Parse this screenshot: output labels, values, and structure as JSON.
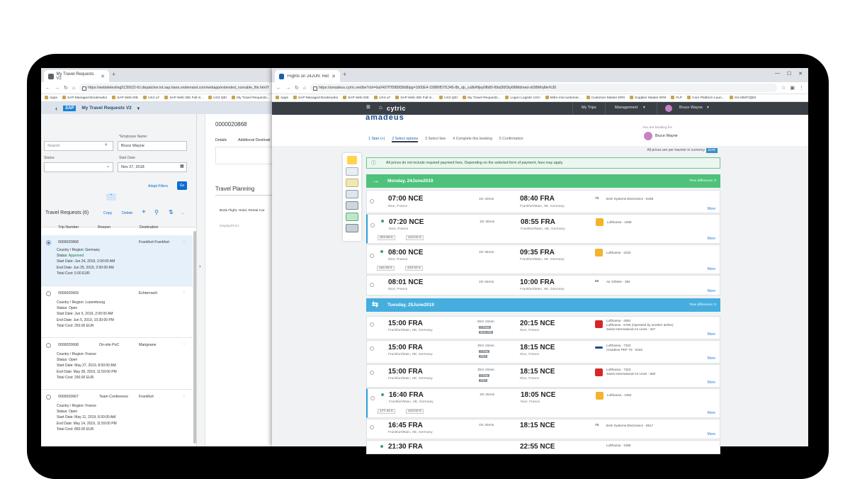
{
  "left_browser": {
    "tab_title": "My Travel Requests V2",
    "url": "https://webidetesting5135622-fcl.dispatcher.int.sap.hana.ondemand.com/webapp/extended_runnable_file.html?hc_orionpath=%2FDI_webide_di_workspace4psvg1bywtw1lb6%2Ftest1&neo-di-affinity=BIGipServerdisapwebide.dc4..",
    "bookmarks": [
      "Apps",
      "SAP Managed Bookmarks",
      "SAP Web IDE",
      "UX4 LF",
      "SAP Web IDE Full-S...",
      "UX3 QEI",
      "My Travel Requests..."
    ],
    "shell_title": "My Travel Requests V2",
    "employee_label": "*Employee Name:",
    "employee_value": "Bruce Wayne",
    "search_placeholder": "Search",
    "status_label": "Status:",
    "start_date_label": "Start Date:",
    "start_date_value": "Nov 27, 2018",
    "adapt_filters": "Adapt Filters",
    "go": "Go",
    "list_title": "Travel Requests (6)",
    "copy": "Copy",
    "delete": "Delete",
    "more": "...",
    "columns": [
      "Trip Number",
      "Reason",
      "Destination"
    ],
    "items": [
      {
        "trip": "0000020868",
        "reason": "",
        "dest": "Frankfurt Frankfurt",
        "country": "Germany",
        "status": "Approved",
        "start": "Jun 24, 2019, 2:00:00 AM",
        "end": "Jun 25, 2019, 2:00:00 AM",
        "cost": "0.00",
        "cur": "EUR"
      },
      {
        "trip": "0000020669",
        "reason": "",
        "dest": "Echternach",
        "country": "Luxembourg",
        "status": "Open",
        "start": "Jun 5, 2019, 2:00:00 AM",
        "end": "Jun 5, 2019, 10:30:00 PM",
        "cost": "250.00",
        "cur": "EUR"
      },
      {
        "trip": "0000020668",
        "reason": "On-site PoC",
        "dest": "Marignane",
        "country": "France",
        "status": "Open",
        "start": "May 27, 2019, 8:00:00 AM",
        "end": "May 28, 2019, 11:59:00 PM",
        "cost": "290.00",
        "cur": "EUR"
      },
      {
        "trip": "0000020667",
        "reason": "Team Conference",
        "dest": "Frankfurt",
        "country": "France",
        "status": "Open",
        "start": "May 11, 2019, 8:30:00 AM",
        "end": "May 14, 2019, 11:59:00 PM",
        "cost": "890.00",
        "cur": "EUR"
      }
    ],
    "labels": {
      "country": "Country / Region:",
      "status": "Status:",
      "start": "Start Date:",
      "end": "End Date:",
      "cost": "Total Cost:"
    },
    "detail_number": "0000020868",
    "detail_tabs": [
      "Details",
      "Additional Destinati"
    ],
    "travel_planning": "Travel Planning",
    "book_flight": "Book Flight, Hotel, Rental Car",
    "display_print": "Display/Print"
  },
  "right_browser": {
    "tab_title": "Flights on 24JUN: Return on 25",
    "url": "https://amadeus.cytric.net/ibe?ctrl=6a0497f7f5f80f38d8ipg=1005E4-15f8f0f57f1345-8b_dp_cu8kRfjep0fb80-f0bd36f3ty6f8Mdmed-dr5BMIqMe%30",
    "bookmarks": [
      "Apps",
      "SAP Managed Bookmarks",
      "SAP Web IDE",
      "UX4 LF",
      "SAP Web IDE Full-S...",
      "UX3 QEI",
      "My Travel Requests...",
      "Logon Logistic UXV",
      "Mdm-md-customer...",
      "Customer Master ER9",
      "Supplier Master ER9",
      "FLP",
      "Core Platform Laun...",
      "S/4 MMT/QBX"
    ],
    "header_logo": "cytric",
    "nav_trips": "My Trips",
    "nav_management": "Management",
    "nav_user": "Bruce Wayne",
    "brand": "amadeus",
    "booking_for_label": "You are booking for:",
    "booking_for_name": "Bruce Wayne",
    "steps": [
      "1 Start (+)",
      "2 Select options",
      "3 Select fare",
      "4 Complete this booking",
      "5 Confirmation"
    ],
    "currency_note": "All prices are per traveler in currency",
    "currency": "EUR",
    "payment_note": "All prices do not include required payment fees. Depending on the selected form of payment, fees may apply.",
    "outbound_date": "Monday, 24June2019",
    "return_date": "Tuesday, 25June2019",
    "time_diff": "Time difference: 0",
    "time_diff_back": "Time difference: 0",
    "more": "More",
    "outbound": [
      {
        "dep": "07:00 NCE",
        "from": "Nice, France",
        "dur": "1hr 40min",
        "arr": "08:40 FRA",
        "to": "Frankfurt/Main, HE, Germany",
        "code": "7X",
        "airline": "BAE Systems Electronics - 9438",
        "price1": "",
        "price2": ""
      },
      {
        "dep": "07:20 NCE",
        "from": "Nice, France",
        "dur": "1hr 35min",
        "arr": "08:55 FRA",
        "to": "Frankfurt/Main, HE, Germany",
        "code": "",
        "airline": "Lufthansa - 1069",
        "price1": "303.58 €",
        "price2": "443.02 €"
      },
      {
        "dep": "08:00 NCE",
        "from": "Nice, France",
        "dur": "1hr 35min",
        "arr": "09:35 FRA",
        "to": "Frankfurt/Main, HE, Germany",
        "code": "",
        "airline": "Lufthansa - 1032",
        "price1": "182.58 €",
        "price2": "443.02 €"
      },
      {
        "dep": "08:01 NCE",
        "from": "Nice, France",
        "dur": "1hr 59min",
        "arr": "10:00 FRA",
        "to": "Frankfurt/Main, HE, Germany",
        "code": "6X",
        "airline": "Air Orfalne - 392",
        "price1": "",
        "price2": ""
      }
    ],
    "return": [
      {
        "dep": "15:00 FRA",
        "from": "Frankfurt/Main, HE, Germany",
        "dur": "5hrs 15min",
        "stop": "1 Stops",
        "via": "MUC 25h",
        "arr": "20:15 NCE",
        "to": "Nice, France",
        "airline": "Lufthansa - 4081",
        "airline2": "Lufthansa - 5765 (Operated by another airline)",
        "airline3": "Swiss International Air Lines - 327"
      },
      {
        "dep": "15:00 FRA",
        "from": "Frankfurt/Main, HE, Germany",
        "dur": "3hrs 15min",
        "stop": "1 Stop",
        "via": "ZRH",
        "arr": "18:15 NCE",
        "to": "Nice, France",
        "airline": "Lufthansa - 7323",
        "airline2": "Amadeus PEP 7S - 5163",
        "airline3": ""
      },
      {
        "dep": "15:00 FRA",
        "from": "Frankfurt/Main, HE, Germany",
        "dur": "3hrs 15min",
        "stop": "1 Stop",
        "via": "ZRH",
        "arr": "18:15 NCE",
        "to": "Nice, France",
        "airline": "Lufthansa - 7323",
        "airline2": "Swiss International Air Lines - 580",
        "airline3": ""
      },
      {
        "dep": "16:40 FRA",
        "from": "Frankfurt/Main, HE, Germany",
        "dur": "1hr 25min",
        "stop": "",
        "via": "",
        "arr": "18:05 NCE",
        "to": "Nice, France",
        "airline": "Lufthansa - 1064",
        "airline2": "",
        "airline3": "",
        "price1": "177.44 €",
        "price2": "443.02 €"
      },
      {
        "dep": "16:45 FRA",
        "from": "Frankfurt/Main, HE, Germany",
        "dur": "1hr 30min",
        "stop": "",
        "via": "",
        "arr": "18:15 NCE",
        "to": "Nice, France",
        "airline": "BAE Systems Electronics - 9817",
        "code": "7X"
      },
      {
        "dep": "21:30 FRA",
        "from": "",
        "dur": "",
        "arr": "22:55 NCE",
        "to": "",
        "airline": "Lufthansa - 1068"
      }
    ]
  },
  "colors": {
    "green_band": "#4ec27a",
    "blue_band": "#45aedf",
    "sap_blue": "#0a6ed1",
    "cytric_header": "#3a3f46"
  }
}
